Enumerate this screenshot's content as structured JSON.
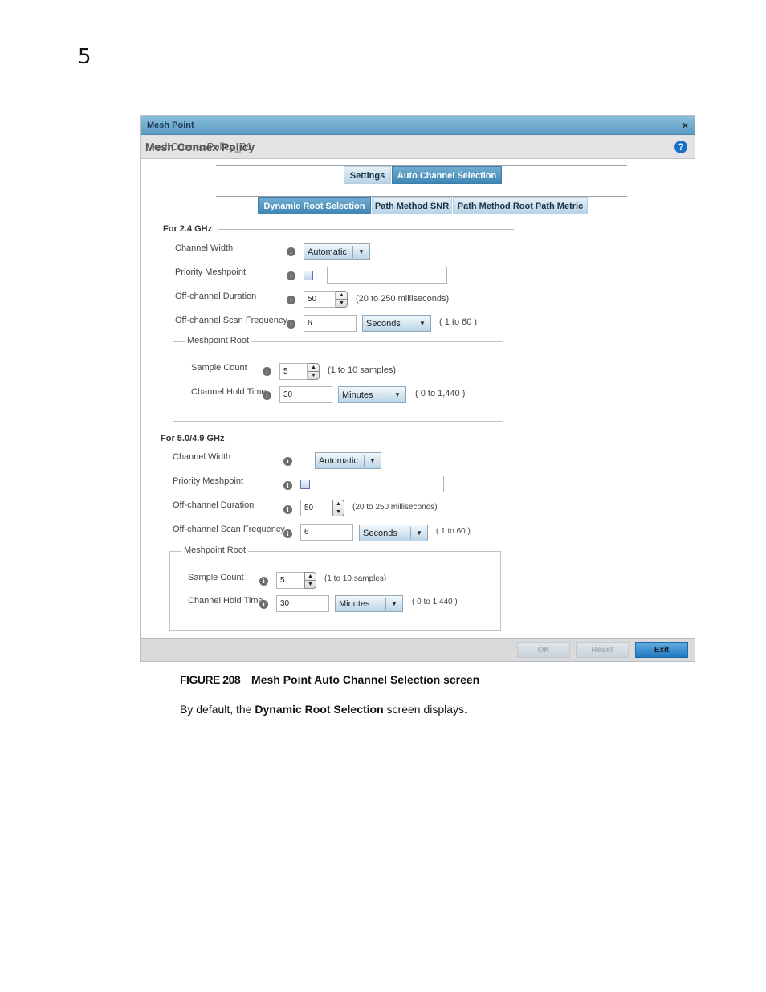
{
  "page_number": "5",
  "dialog": {
    "title": "Mesh Point",
    "close_icon": "×",
    "policy_label": "Mesh Connex Policy",
    "policy_value": "MeshConnexPolicy_01",
    "help_icon": "?"
  },
  "tabs": [
    {
      "label": "Settings",
      "active": false
    },
    {
      "label": "Auto Channel Selection",
      "active": true
    }
  ],
  "subtabs": [
    {
      "label": "Dynamic Root Selection",
      "active": true
    },
    {
      "label": "Path Method SNR",
      "active": false
    },
    {
      "label": "Path Method Root Path Metric",
      "active": false
    }
  ],
  "bands": [
    {
      "header": "For 2.4 GHz",
      "channel_width": {
        "label": "Channel Width",
        "value": "Automatic"
      },
      "priority_meshpoint": {
        "label": "Priority Meshpoint",
        "checked": false,
        "value": ""
      },
      "off_channel_duration": {
        "label": "Off-channel Duration",
        "value": "50",
        "hint": "(20 to 250 milliseconds)"
      },
      "off_channel_scan_frequency": {
        "label": "Off-channel Scan Frequency",
        "value": "6",
        "unit": "Seconds",
        "hint": "( 1 to 60 )"
      },
      "meshpoint_root": {
        "legend": "Meshpoint Root",
        "sample_count": {
          "label": "Sample Count",
          "value": "5",
          "hint": "(1 to 10 samples)"
        },
        "channel_hold_time": {
          "label": "Channel Hold Time",
          "value": "30",
          "unit": "Minutes",
          "hint": "( 0 to 1,440 )"
        }
      }
    },
    {
      "header": "For 5.0/4.9 GHz",
      "channel_width": {
        "label": "Channel Width",
        "value": "Automatic"
      },
      "priority_meshpoint": {
        "label": "Priority Meshpoint",
        "checked": false,
        "value": ""
      },
      "off_channel_duration": {
        "label": "Off-channel Duration",
        "value": "50",
        "hint": "(20 to 250 milliseconds)"
      },
      "off_channel_scan_frequency": {
        "label": "Off-channel Scan Frequency",
        "value": "6",
        "unit": "Seconds",
        "hint": "( 1 to 60 )"
      },
      "meshpoint_root": {
        "legend": "Meshpoint Root",
        "sample_count": {
          "label": "Sample Count",
          "value": "5",
          "hint": "(1 to 10 samples)"
        },
        "channel_hold_time": {
          "label": "Channel Hold Time",
          "value": "30",
          "unit": "Minutes",
          "hint": "( 0 to 1,440 )"
        }
      }
    }
  ],
  "icons": {
    "info": "i",
    "dropdown": "▼",
    "spin_up": "▲",
    "spin_down": "▼"
  },
  "footer": {
    "ok": "OK",
    "reset": "Reset",
    "exit": "Exit"
  },
  "caption": {
    "figure": "FIGURE 208",
    "text": "Mesh Point Auto Channel Selection screen"
  },
  "paragraph": {
    "before": "By default, the ",
    "bold": "Dynamic Root Selection",
    "after": " screen displays."
  }
}
